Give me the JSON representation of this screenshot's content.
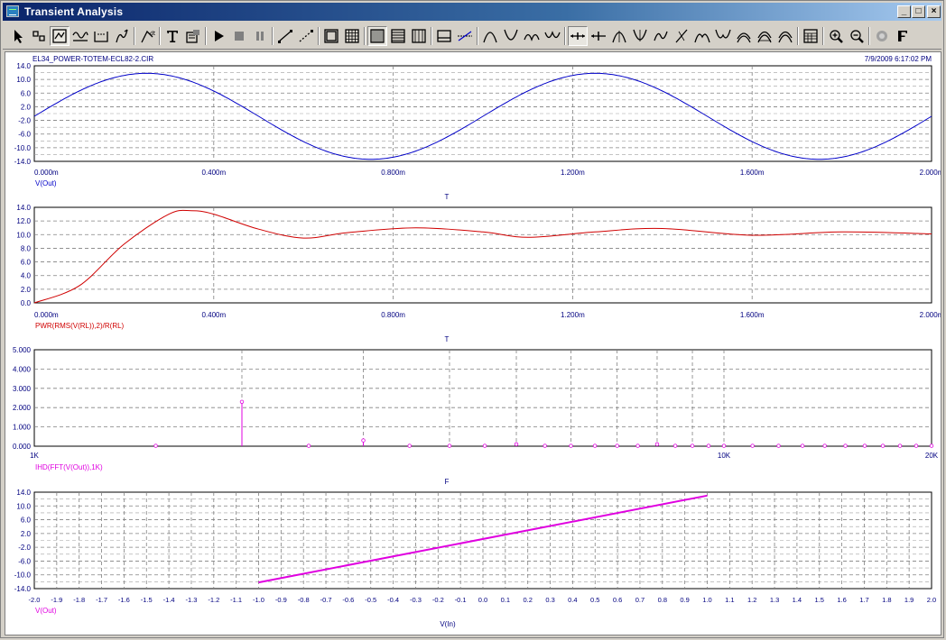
{
  "window": {
    "title": "Transient Analysis",
    "min_glyph": "_",
    "max_glyph": "□",
    "close_glyph": "×"
  },
  "toolbar": {
    "icons": [
      "select-arrow-icon",
      "component-icon",
      "analysis-limits-icon",
      "waveform-icon",
      "scope-icon",
      "derivative-icon",
      "x-axis-icon",
      "text-icon",
      "properties-icon",
      "run-icon",
      "stop-icon",
      "pause-icon",
      "line-icon",
      "dash-line-icon",
      "frame-icon",
      "grid-icon",
      "minor-grid-icon",
      "major-grid-icon",
      "token-grid-icon",
      "baseline-icon",
      "horizontal-axis-icon",
      "peak-icon",
      "valley-icon",
      "high-icon",
      "low-icon",
      "cursor-left-icon",
      "cursor-right-icon",
      "next-peak-icon",
      "next-valley-icon",
      "inflection-icon",
      "slope-icon",
      "global-high-icon",
      "global-low-icon",
      "point-tag-icon",
      "horizontal-tag-icon",
      "vertical-tag-icon",
      "performance-icon",
      "zoom-in-icon",
      "zoom-out-icon",
      "settings-icon",
      "font-icon"
    ]
  },
  "header": {
    "circuit_name": "EL34_POWER-TOTEM-ECL82-2.CIR",
    "timestamp": "7/9/2009 6:17:02 PM"
  },
  "colors": {
    "blue": "#0000c8",
    "red": "#d00000",
    "magenta": "#e000e0",
    "axis_text": "#000080",
    "grid": "#808080"
  },
  "chart_data": [
    {
      "type": "line",
      "series": [
        {
          "name": "V(Out)",
          "function": "12.6*sin(2*pi*1000*t) - 0.8",
          "x": [
            0,
            0.00025,
            0.0005,
            0.00075,
            0.001,
            0.00125,
            0.0015,
            0.00175,
            0.002
          ],
          "y": [
            -0.8,
            12.6,
            -0.8,
            -12.6,
            -0.8,
            12.6,
            -0.8,
            -12.6,
            -0.8
          ]
        }
      ],
      "xlabel": "T",
      "ylabel": "V(Out)",
      "xlim": [
        0,
        0.002
      ],
      "ylim": [
        -14,
        14
      ],
      "x_tick_labels": [
        "0.000m",
        "0.400m",
        "0.800m",
        "1.200m",
        "1.600m",
        "2.000m"
      ],
      "y_tick_labels": [
        "14.0",
        "10.0",
        "6.0",
        "2.0",
        "-2.0",
        "-6.0",
        "-10.0",
        "-14.0"
      ],
      "color": "#0000c8",
      "grid": true
    },
    {
      "type": "line",
      "series": [
        {
          "name": "PWR(RMS(V(RL)),2)/R(RL)",
          "x": [
            0,
            0.0001,
            0.0002,
            0.0003,
            0.00035,
            0.0004,
            0.0005,
            0.0006,
            0.0007,
            0.00085,
            0.001,
            0.0011,
            0.00125,
            0.0014,
            0.0016,
            0.0018,
            0.002
          ],
          "y": [
            0,
            2.5,
            8.6,
            13.0,
            13.5,
            13.0,
            10.8,
            9.5,
            10.3,
            11.0,
            10.4,
            9.6,
            10.4,
            10.9,
            9.9,
            10.4,
            10.1
          ]
        }
      ],
      "xlabel": "T",
      "ylabel": "PWR(RMS(V(RL)),2)/R(RL)",
      "xlim": [
        0,
        0.002
      ],
      "ylim": [
        0,
        14
      ],
      "x_tick_labels": [
        "0.000m",
        "0.400m",
        "0.800m",
        "1.200m",
        "1.600m",
        "2.000m"
      ],
      "y_tick_labels": [
        "14.0",
        "12.0",
        "10.0",
        "8.0",
        "6.0",
        "4.0",
        "2.0",
        "0.0"
      ],
      "color": "#d00000",
      "grid": true
    },
    {
      "type": "scatter",
      "scale": "log-x",
      "series": [
        {
          "name": "IHD(FFT(V(Out)),1K)",
          "x": [
            1500,
            2000,
            2500,
            3000,
            3500,
            4000,
            4500,
            5000,
            5500,
            6000,
            6500,
            7000,
            7500,
            8000,
            8500,
            9000,
            9500,
            10000,
            11000,
            12000,
            13000,
            14000,
            15000,
            16000,
            17000,
            18000,
            19000,
            20000
          ],
          "y": [
            0.02,
            2.3,
            0.02,
            0.3,
            0.02,
            0.02,
            0.02,
            0.1,
            0.02,
            0.02,
            0.02,
            0.02,
            0.02,
            0.1,
            0.02,
            0.02,
            0.02,
            0.02,
            0.02,
            0.02,
            0.02,
            0.02,
            0.02,
            0.02,
            0.02,
            0.02,
            0.02,
            0.02
          ]
        }
      ],
      "xlabel": "F",
      "ylabel": "IHD(FFT(V(Out)),1K)",
      "xlim": [
        1000,
        20000
      ],
      "ylim": [
        0,
        5
      ],
      "x_tick_labels": [
        "1K",
        "10K",
        "20K"
      ],
      "y_tick_labels": [
        "5.000",
        "4.000",
        "3.000",
        "2.000",
        "1.000",
        "0.000"
      ],
      "color": "#e000e0",
      "grid": true
    },
    {
      "type": "line",
      "series": [
        {
          "name": "V(Out)",
          "x": [
            -1.0,
            1.0
          ],
          "y": [
            -12.2,
            13.0
          ]
        }
      ],
      "xlabel": "V(In)",
      "ylabel": "V(Out)",
      "xlim": [
        -2.0,
        2.0
      ],
      "ylim": [
        -14,
        14
      ],
      "x_tick_labels": [
        "-2.0",
        "-1.9",
        "-1.8",
        "-1.7",
        "-1.6",
        "-1.5",
        "-1.4",
        "-1.3",
        "-1.2",
        "-1.1",
        "-1.0",
        "-0.9",
        "-0.8",
        "-0.7",
        "-0.6",
        "-0.5",
        "-0.4",
        "-0.3",
        "-0.2",
        "-0.1",
        "0.0",
        "0.1",
        "0.2",
        "0.3",
        "0.4",
        "0.5",
        "0.6",
        "0.7",
        "0.8",
        "0.9",
        "1.0",
        "1.1",
        "1.2",
        "1.3",
        "1.4",
        "1.5",
        "1.6",
        "1.7",
        "1.8",
        "1.9",
        "2.0"
      ],
      "y_tick_labels": [
        "14.0",
        "10.0",
        "6.0",
        "2.0",
        "-2.0",
        "-6.0",
        "-10.0",
        "-14.0"
      ],
      "color": "#e000e0",
      "grid": true
    }
  ]
}
